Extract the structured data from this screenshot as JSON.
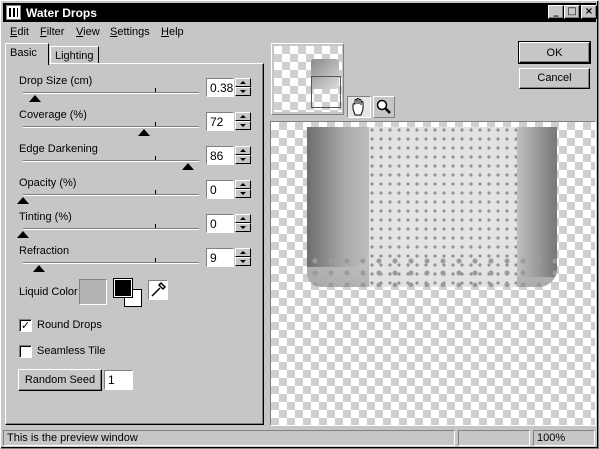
{
  "window": {
    "title": "Water Drops"
  },
  "titlebar_buttons": {
    "minimize": "_",
    "maximize": "□",
    "close": "×"
  },
  "menu": [
    {
      "label": "Edit",
      "accel": "E",
      "rest": "dit"
    },
    {
      "label": "Filter",
      "accel": "F",
      "rest": "ilter"
    },
    {
      "label": "View",
      "accel": "V",
      "rest": "iew"
    },
    {
      "label": "Settings",
      "accel": "S",
      "rest": "ettings"
    },
    {
      "label": "Help",
      "accel": "H",
      "rest": "elp"
    }
  ],
  "tabs": {
    "basic": "Basic",
    "lighting": "Lighting",
    "selected": "Basic"
  },
  "controls": [
    {
      "label": "Drop Size (cm)",
      "value": "0.38",
      "fraction": 0.07
    },
    {
      "label": "Coverage (%)",
      "value": "72",
      "fraction": 0.69
    },
    {
      "label": "Edge Darkening",
      "value": "86",
      "fraction": 0.94
    },
    {
      "label": "Opacity (%)",
      "value": "0",
      "fraction": 0.0
    },
    {
      "label": "Tinting (%)",
      "value": "0",
      "fraction": 0.0
    },
    {
      "label": "Refraction",
      "value": "9",
      "fraction": 0.09
    }
  ],
  "liquid_color": {
    "label": "Liquid Color",
    "swatch": "#b4b4b4",
    "foreground": "#000000",
    "background": "#ffffff"
  },
  "round_drops": {
    "label": "Round Drops",
    "checked": true
  },
  "seamless_tile": {
    "label": "Seamless Tile",
    "checked": false
  },
  "random_seed": {
    "button": "Random Seed",
    "value": "1"
  },
  "buttons": {
    "ok": "OK",
    "cancel": "Cancel"
  },
  "tools": {
    "hand": "hand-icon",
    "zoom": "magnifier-icon"
  },
  "status": {
    "message": "This is the preview window",
    "zoom": "100%"
  }
}
